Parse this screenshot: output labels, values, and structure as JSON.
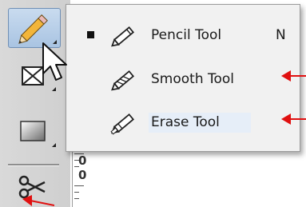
{
  "toolbar": {
    "tools": [
      {
        "icon": "pencil-icon",
        "active": true
      },
      {
        "icon": "box-x-icon",
        "active": false
      },
      {
        "icon": "gradient-icon",
        "active": false
      },
      {
        "icon": "scissors-icon",
        "active": false
      }
    ]
  },
  "ruler": {
    "numbers": [
      "0",
      "0"
    ]
  },
  "flyout": {
    "items": [
      {
        "label": "Pencil Tool",
        "shortcut": "N",
        "icon": "pencil-icon",
        "checked": true
      },
      {
        "label": "Smooth Tool",
        "shortcut": "",
        "icon": "smooth-pencil-icon",
        "checked": false
      },
      {
        "label": "Erase Tool",
        "shortcut": "",
        "icon": "erase-pencil-icon",
        "checked": false
      }
    ]
  },
  "annotations": {
    "arrow_color": "#e01010"
  },
  "colors": {
    "toolbar_bg": "#d4d4d4",
    "flyout_bg": "#f1f1f1",
    "active_tool_bg": "#b8cfe9"
  }
}
